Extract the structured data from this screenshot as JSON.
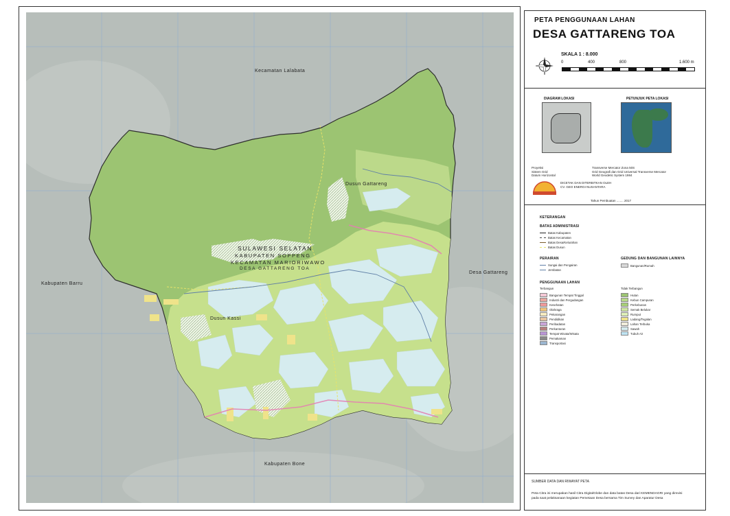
{
  "map": {
    "place_labels": {
      "north": "Kecamatan Lalabata",
      "west": "Kabupaten Barru",
      "east": "Desa Gattareng",
      "south": "Kabupaten Bone",
      "dusun_gattareng": "Dusun Gattareng",
      "dusun_kessi": "Dusun Kassi"
    },
    "region_block": {
      "province": "SULAWESI SELATAN",
      "regency": "KABUPATEN SOPPENG",
      "district": "KECAMATAN MARIORIWAWO",
      "village": "DESA GATTARENG TOA"
    },
    "colors": {
      "forest": "#9cc472",
      "mixed_garden": "#c6e08c",
      "paddy": "#d6ecef",
      "dry_field": "#efe38a",
      "road": "#e37fb1",
      "imagery": "#b9c0bd"
    }
  },
  "title": {
    "subtitle": "PETA PENGGUNAAN LAHAN",
    "main": "DESA GATTARENG TOA"
  },
  "scale": {
    "label": "SKALA 1 : 8.000",
    "ticks": [
      "0",
      "400",
      "800",
      "1.600 m"
    ]
  },
  "inset": {
    "diagram_title": "DIAGRAM LOKASI",
    "guide_title": "PETUNJUK PETA LOKASI"
  },
  "projection": {
    "rows": [
      {
        "k": "Proyeksi",
        "v": "Transverse Mercator Zona 50S"
      },
      {
        "k": "Sistem Grid",
        "v": "Grid Geografi dan Grid Universal Transverse Mercator"
      },
      {
        "k": "Datum Horizontal",
        "v": "World Geodetic System 1984"
      }
    ]
  },
  "publisher": {
    "line1": "DICETAK DAN DITERBITKAN OLEH",
    "line2": "CV. GEO ENERGI NUSANTARA",
    "year_label": "Tahun Pembuatan ........ 2017"
  },
  "legend": {
    "title": "KETERANGAN",
    "admin_title": "BATAS ADMINISTRASI",
    "admin_items": [
      "Batas Kabupaten",
      "Batas Kecamatan",
      "Batas Desa/Kelurahan",
      "Batas Dusun"
    ],
    "water_title": "PERAIRAN",
    "water_items": [
      "Sungai dan Pengairan",
      "Jembatan"
    ],
    "building_title": "GEDUNG DAN BANGUNAN LAINNYA",
    "building_items": [
      "Bangunan/Rumah"
    ],
    "landuse_title": "PENGGUNAAN LAHAN",
    "built_title": "Terbangun",
    "built_items": [
      {
        "label": "Bangunan Tempat Tinggal",
        "color": "#f4c9d6"
      },
      {
        "label": "Industri dan Pergudangan",
        "color": "#e9a7a0"
      },
      {
        "label": "Kesehatan",
        "color": "#f09a9a"
      },
      {
        "label": "Olahraga",
        "color": "#f2c57c"
      },
      {
        "label": "Pekarangan",
        "color": "#f8ecc0"
      },
      {
        "label": "Pendidikan",
        "color": "#e8c4a0"
      },
      {
        "label": "Peribadatan",
        "color": "#c9a5d8"
      },
      {
        "label": "Perkantoran",
        "color": "#b77f7f"
      },
      {
        "label": "Tempat Wisata/Wisata",
        "color": "#b995d6"
      },
      {
        "label": "Pemakaman",
        "color": "#8a8a8a"
      },
      {
        "label": "Transportasi",
        "color": "#9bb6d0"
      }
    ],
    "unbuilt_title": "Tidak Terbangun",
    "unbuilt_items": [
      {
        "label": "Hutan",
        "color": "#9cc472"
      },
      {
        "label": "Kebun Campuran",
        "color": "#b9d98a"
      },
      {
        "label": "Perkebunan",
        "color": "#a8cf78"
      },
      {
        "label": "Semak Belukar",
        "color": "#cfe6a2"
      },
      {
        "label": "Rumput",
        "color": "#dff0b8"
      },
      {
        "label": "Ladang/Tegalan",
        "color": "#efe38a"
      },
      {
        "label": "Lahan Terbuka",
        "color": "#f2eedc"
      },
      {
        "label": "Sawah",
        "color": "#d6ecef"
      },
      {
        "label": "Tubuh Air",
        "color": "#bfe3f2"
      }
    ]
  },
  "source": {
    "title": "SUMBER DATA DAN RIWAYAT PETA",
    "text1": "Peta Citra ini merupakan hasil Citra DigitalGlobe dan data batas Desa dari KEMENDAGRI yang direvisi",
    "text2": "pada saat pelaksanaan kegiatan Pemetaan Desa bersama Tim Survey dan Aparatur Desa"
  }
}
